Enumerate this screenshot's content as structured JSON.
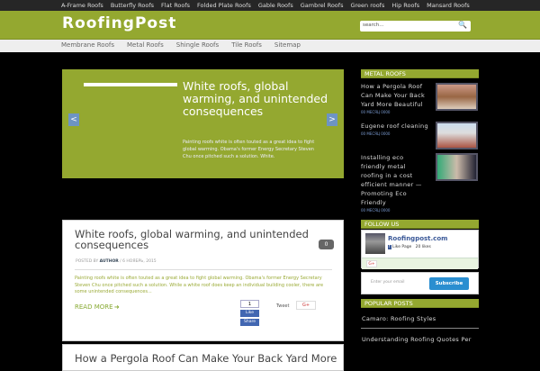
{
  "topbar": {
    "links": [
      "A-Frame Roofs",
      "Butterfly Roofs",
      "Flat Roofs",
      "Folded Plate Roofs",
      "Gable Roofs",
      "Gambrel Roofs",
      "Green roofs",
      "Hip Roofs",
      "Mansard Roofs"
    ]
  },
  "header": {
    "logo": "RoofingPost",
    "search_placeholder": "search..."
  },
  "nav": {
    "links": [
      "Membrane Roofs",
      "Metal Roofs",
      "Shingle Roofs",
      "Tile Roofs",
      "Sitemap"
    ]
  },
  "slider": {
    "title": "White roofs, global warming, and unintended consequences",
    "text": "Painting roofs white is often touted as a great idea to fight global warming. Obama's former Energy Secretary Steven Chu once pitched such a solution. White.",
    "prev": "<",
    "next": ">"
  },
  "posts": [
    {
      "title": "White roofs, global warming, and unintended consequences",
      "meta_prefix": "POSTED BY ",
      "author": "AUTHOR",
      "date": " / 6 НОЯБРЬ, 2015",
      "comments": "0",
      "excerpt": "Painting roofs white is often touted as a great idea to fight global warming. Obama's former Energy Secretary Steven Chu once pitched such a solution. While a white roof does keep an individual building cooler, there are some unintended consequences...",
      "read_more": "READ MORE",
      "fb_count": "1",
      "fb_like": "Like",
      "fb_share": "Share",
      "tweet": "Tweet",
      "gplus": "G+"
    },
    {
      "title": "How a Pergola Roof Can Make Your Back Yard More"
    }
  ],
  "sidebar": {
    "metal_title": "METAL ROOFS",
    "metal_items": [
      {
        "title": "How a Pergola Roof Can Make Your Back Yard More Beautiful",
        "date": "00 МЕСЯЦ 0000"
      },
      {
        "title": "Eugene roof cleaning",
        "date": "00 МЕСЯЦ 0000"
      },
      {
        "title": "Installing eco friendly metal roofing in a cost efficient manner — Promoting Eco Friendly",
        "date": "00 МЕСЯЦ 0000"
      }
    ],
    "follow_title": "FOLLOW US",
    "fb_name": "Roofingpost.com",
    "fb_like_page": "Like Page",
    "fb_likes": "20 likes",
    "gplus": "G+",
    "email_placeholder": "Enter your email",
    "subscribe": "Subscribe",
    "popular_title": "POPULAR POSTS",
    "popular": [
      "Camaro: Roofing Styles",
      "Understanding Roofing Quotes Per"
    ]
  }
}
